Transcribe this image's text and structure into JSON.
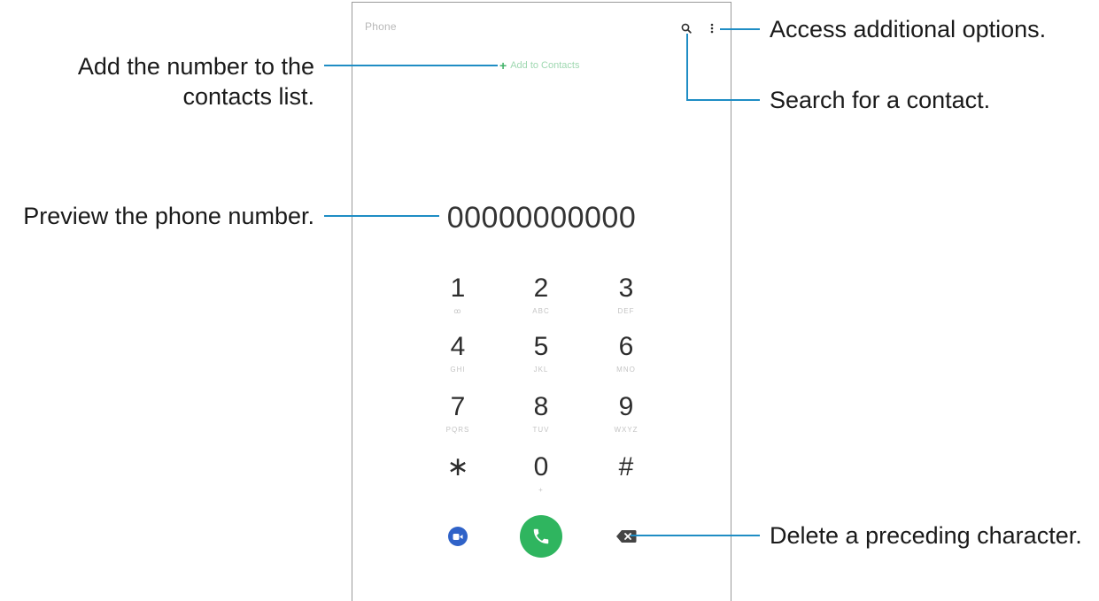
{
  "phone": {
    "app_title": "Phone",
    "add_contact_label": "Add to Contacts",
    "number_display": "00000000000",
    "keypad": [
      {
        "digit": "1",
        "sub": "ꝏ"
      },
      {
        "digit": "2",
        "sub": "ABC"
      },
      {
        "digit": "3",
        "sub": "DEF"
      },
      {
        "digit": "4",
        "sub": "GHI"
      },
      {
        "digit": "5",
        "sub": "JKL"
      },
      {
        "digit": "6",
        "sub": "MNO"
      },
      {
        "digit": "7",
        "sub": "PQRS"
      },
      {
        "digit": "8",
        "sub": "TUV"
      },
      {
        "digit": "9",
        "sub": "WXYZ"
      },
      {
        "digit": "∗",
        "sub": ""
      },
      {
        "digit": "0",
        "sub": "+"
      },
      {
        "digit": "#",
        "sub": ""
      }
    ],
    "icons": {
      "search": "search-icon",
      "more": "more-options-icon",
      "video": "video-call-icon",
      "call": "phone-call-icon",
      "backspace": "backspace-icon"
    },
    "colors": {
      "call_green": "#2fb55f",
      "video_blue": "#2f62c8",
      "callout_line": "#1f8dc4"
    }
  },
  "callouts": {
    "add_contact": "Add the number to the\ncontacts list.",
    "preview": "Preview the phone number.",
    "options": "Access additional options.",
    "search": "Search for a contact.",
    "delete": "Delete a preceding character."
  }
}
